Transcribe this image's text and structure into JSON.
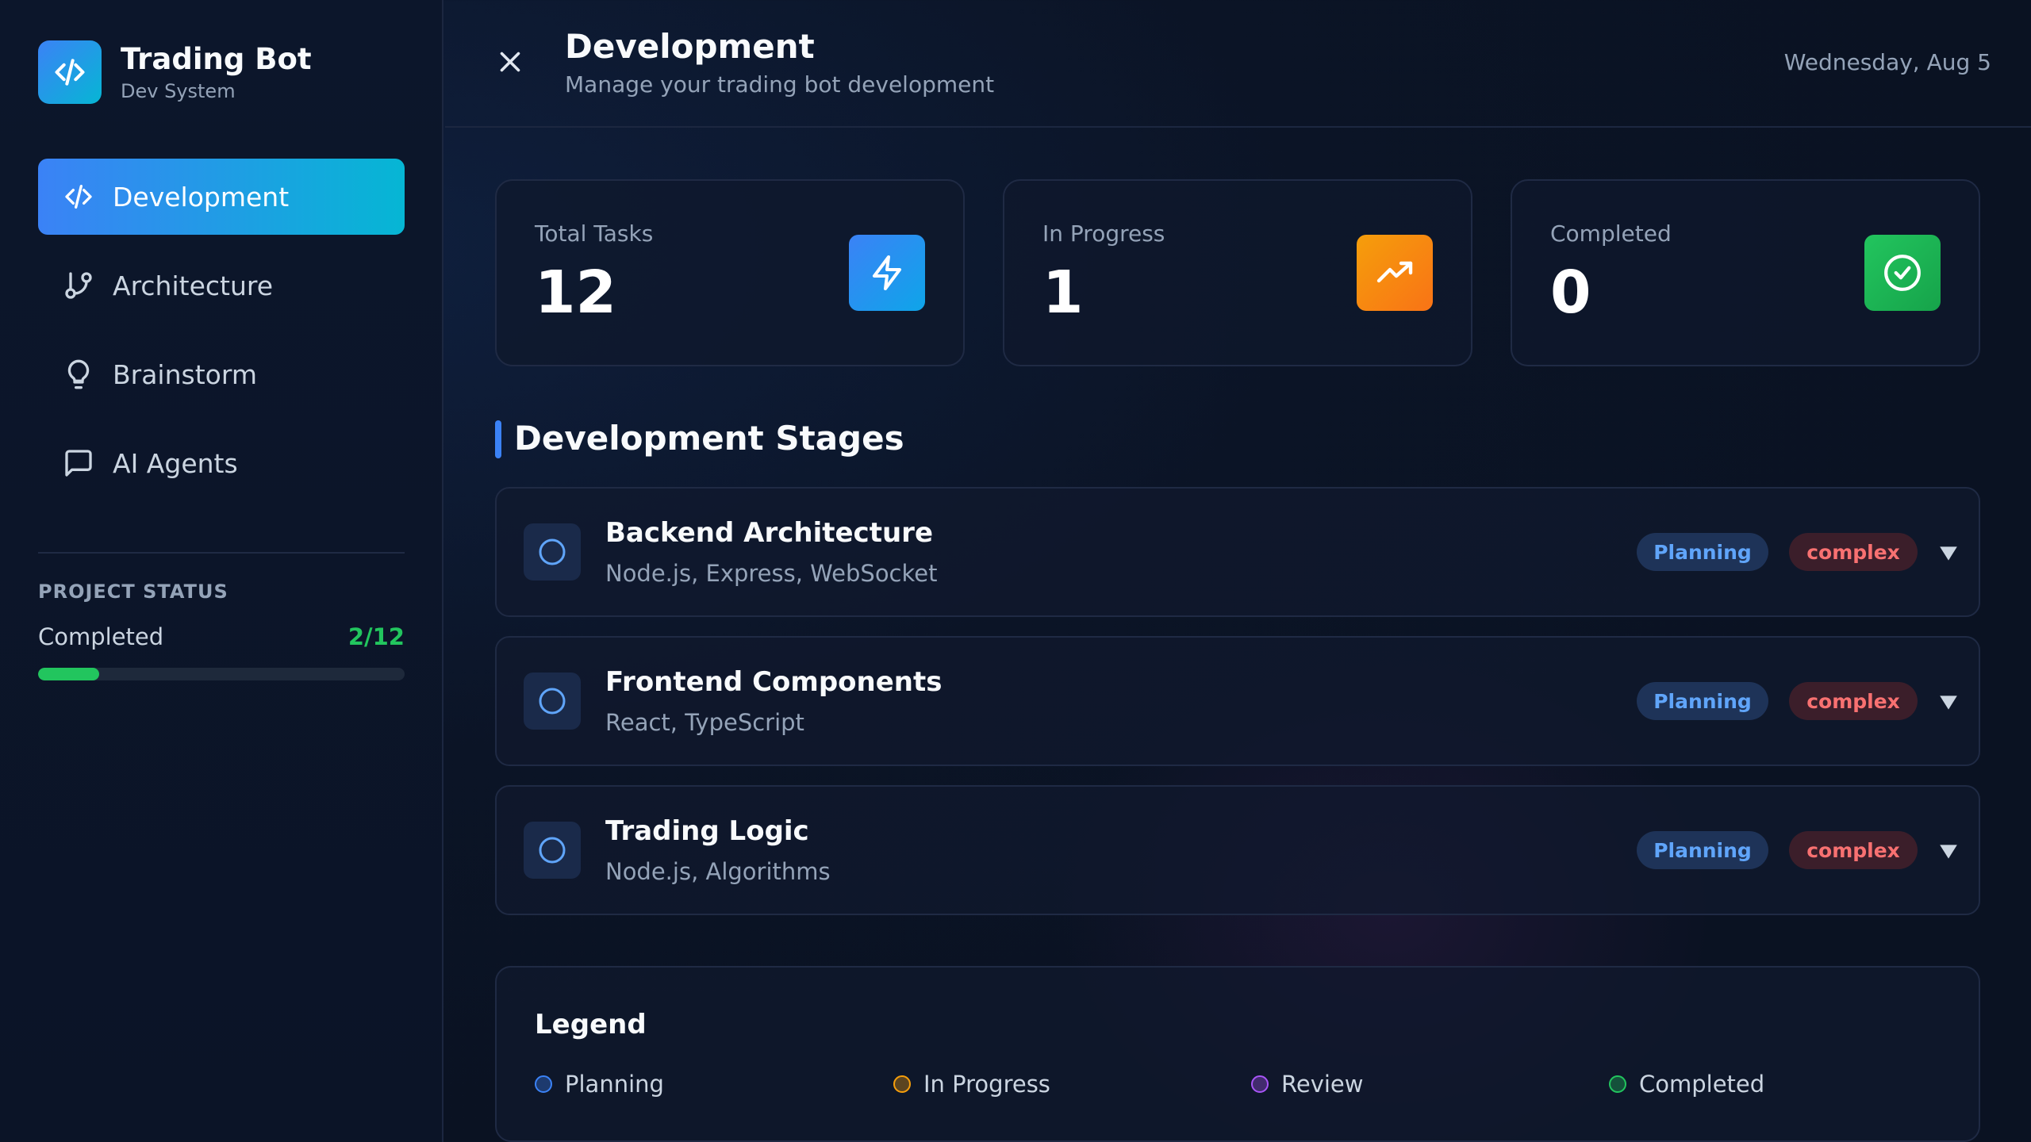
{
  "brand": {
    "title": "Trading Bot",
    "subtitle": "Dev System",
    "logo_icon": "code-icon"
  },
  "sidebar": {
    "items": [
      {
        "label": "Development",
        "icon": "code-icon",
        "active": true
      },
      {
        "label": "Architecture",
        "icon": "git-branch-icon",
        "active": false
      },
      {
        "label": "Brainstorm",
        "icon": "lightbulb-icon",
        "active": false
      },
      {
        "label": "AI Agents",
        "icon": "message-square-icon",
        "active": false
      }
    ],
    "project_status": {
      "title": "PROJECT STATUS",
      "label": "Completed",
      "count": "2/12",
      "progress": 0.1667
    }
  },
  "header": {
    "title": "Development",
    "subtitle": "Manage your trading bot development",
    "date": "Wednesday, Aug 5"
  },
  "stats": [
    {
      "label": "Total Tasks",
      "value": "12",
      "icon": "zap-icon",
      "color": "#3b82f6"
    },
    {
      "label": "In Progress",
      "value": "1",
      "icon": "trending-up-icon",
      "color": "#f59e0b"
    },
    {
      "label": "Completed",
      "value": "0",
      "icon": "check-circle-icon",
      "color": "#22c55e"
    }
  ],
  "section": {
    "title": "Development Stages"
  },
  "stages": [
    {
      "name": "Backend Architecture",
      "tech": "Node.js, Express, WebSocket",
      "status": "Planning",
      "complexity": "complex"
    },
    {
      "name": "Frontend Components",
      "tech": "React, TypeScript",
      "status": "Planning",
      "complexity": "complex"
    },
    {
      "name": "Trading Logic",
      "tech": "Node.js, Algorithms",
      "status": "Planning",
      "complexity": "complex"
    }
  ],
  "legend": {
    "title": "Legend",
    "items": [
      {
        "label": "Planning",
        "color": "#3b82f6"
      },
      {
        "label": "In Progress",
        "color": "#f59e0b"
      },
      {
        "label": "Review",
        "color": "#a855f7"
      },
      {
        "label": "Completed",
        "color": "#22c55e"
      }
    ]
  }
}
